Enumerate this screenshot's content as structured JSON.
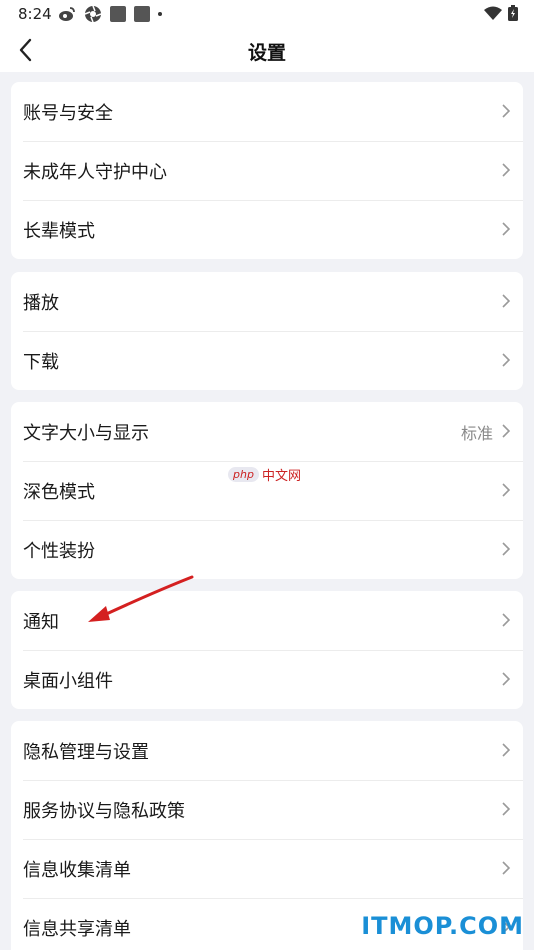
{
  "status_bar": {
    "time": "8:24"
  },
  "header": {
    "title": "设置"
  },
  "groups": [
    {
      "items": [
        {
          "label": "账号与安全"
        },
        {
          "label": "未成年人守护中心"
        },
        {
          "label": "长辈模式"
        }
      ]
    },
    {
      "items": [
        {
          "label": "播放"
        },
        {
          "label": "下载"
        }
      ]
    },
    {
      "items": [
        {
          "label": "文字大小与显示",
          "value": "标准"
        },
        {
          "label": "深色模式"
        },
        {
          "label": "个性装扮"
        }
      ]
    },
    {
      "items": [
        {
          "label": "通知"
        },
        {
          "label": "桌面小组件"
        }
      ]
    },
    {
      "items": [
        {
          "label": "隐私管理与设置"
        },
        {
          "label": "服务协议与隐私政策"
        },
        {
          "label": "信息收集清单"
        },
        {
          "label": "信息共享清单"
        }
      ]
    }
  ],
  "watermark": {
    "php": "php",
    "cn": "中文网"
  },
  "brand": "ITMOP.COM",
  "colors": {
    "annotation_arrow": "#d42020",
    "brand": "#1a8fd6"
  }
}
